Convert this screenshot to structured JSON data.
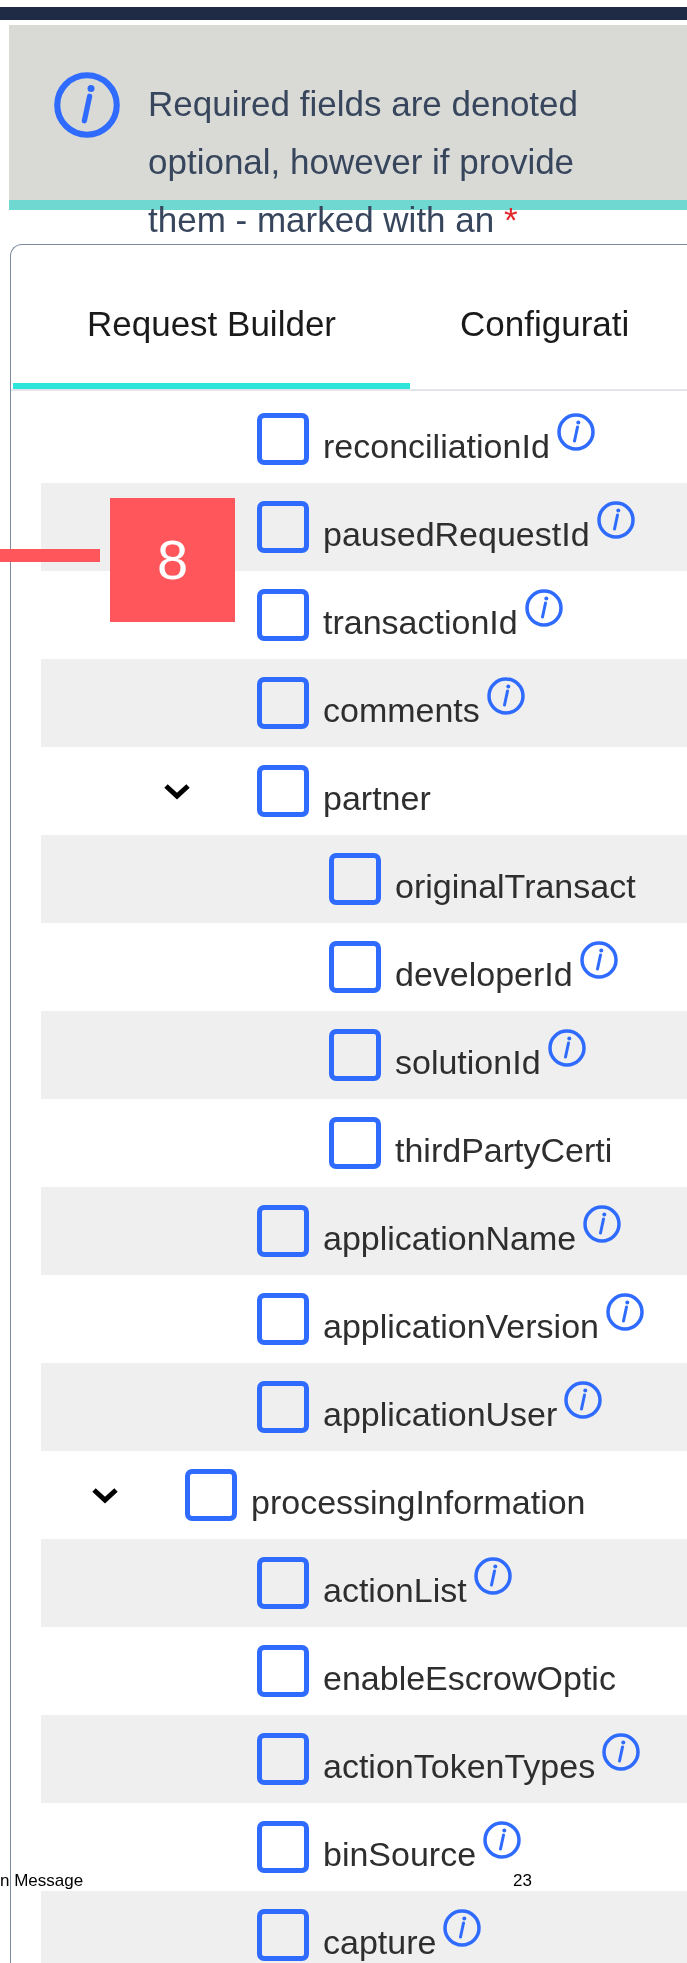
{
  "notice": {
    "lines": [
      "Required fields are denoted",
      "optional, however if provide",
      "them - marked with an"
    ],
    "required_mark": "*"
  },
  "tabs": [
    {
      "label": "Request Builder",
      "selected": true
    },
    {
      "label": "Configurati",
      "selected": false
    }
  ],
  "tree": [
    {
      "children": [
        {
          "label": "reconciliationId",
          "checked": false,
          "info": true
        },
        {
          "label": "pausedRequestId",
          "checked": false,
          "info": true
        },
        {
          "label": "transactionId",
          "checked": false,
          "info": true
        },
        {
          "label": "comments",
          "checked": false,
          "info": true
        },
        {
          "label": "partner",
          "checked": false,
          "info": false,
          "expanded": true,
          "children": [
            {
              "label": "originalTransact",
              "checked": false,
              "info": false
            },
            {
              "label": "developerId",
              "checked": false,
              "info": true
            },
            {
              "label": "solutionId",
              "checked": false,
              "info": true
            },
            {
              "label": "thirdPartyCerti",
              "checked": false,
              "info": false
            }
          ]
        },
        {
          "label": "applicationName",
          "checked": false,
          "info": true
        },
        {
          "label": "applicationVersion",
          "checked": false,
          "info": true
        },
        {
          "label": "applicationUser",
          "checked": false,
          "info": true
        }
      ]
    },
    {
      "label": "processingInformation",
      "checked": false,
      "info": false,
      "expanded": true,
      "children": [
        {
          "label": "actionList",
          "checked": false,
          "info": true
        },
        {
          "label": "enableEscrowOptic",
          "checked": false,
          "info": false
        },
        {
          "label": "actionTokenTypes",
          "checked": false,
          "info": true
        },
        {
          "label": "binSource",
          "checked": false,
          "info": true
        },
        {
          "label": "capture",
          "checked": false,
          "info": true
        }
      ]
    }
  ],
  "callout": {
    "number": "8"
  },
  "footer": {
    "text": "n Message",
    "page_number": "23"
  }
}
